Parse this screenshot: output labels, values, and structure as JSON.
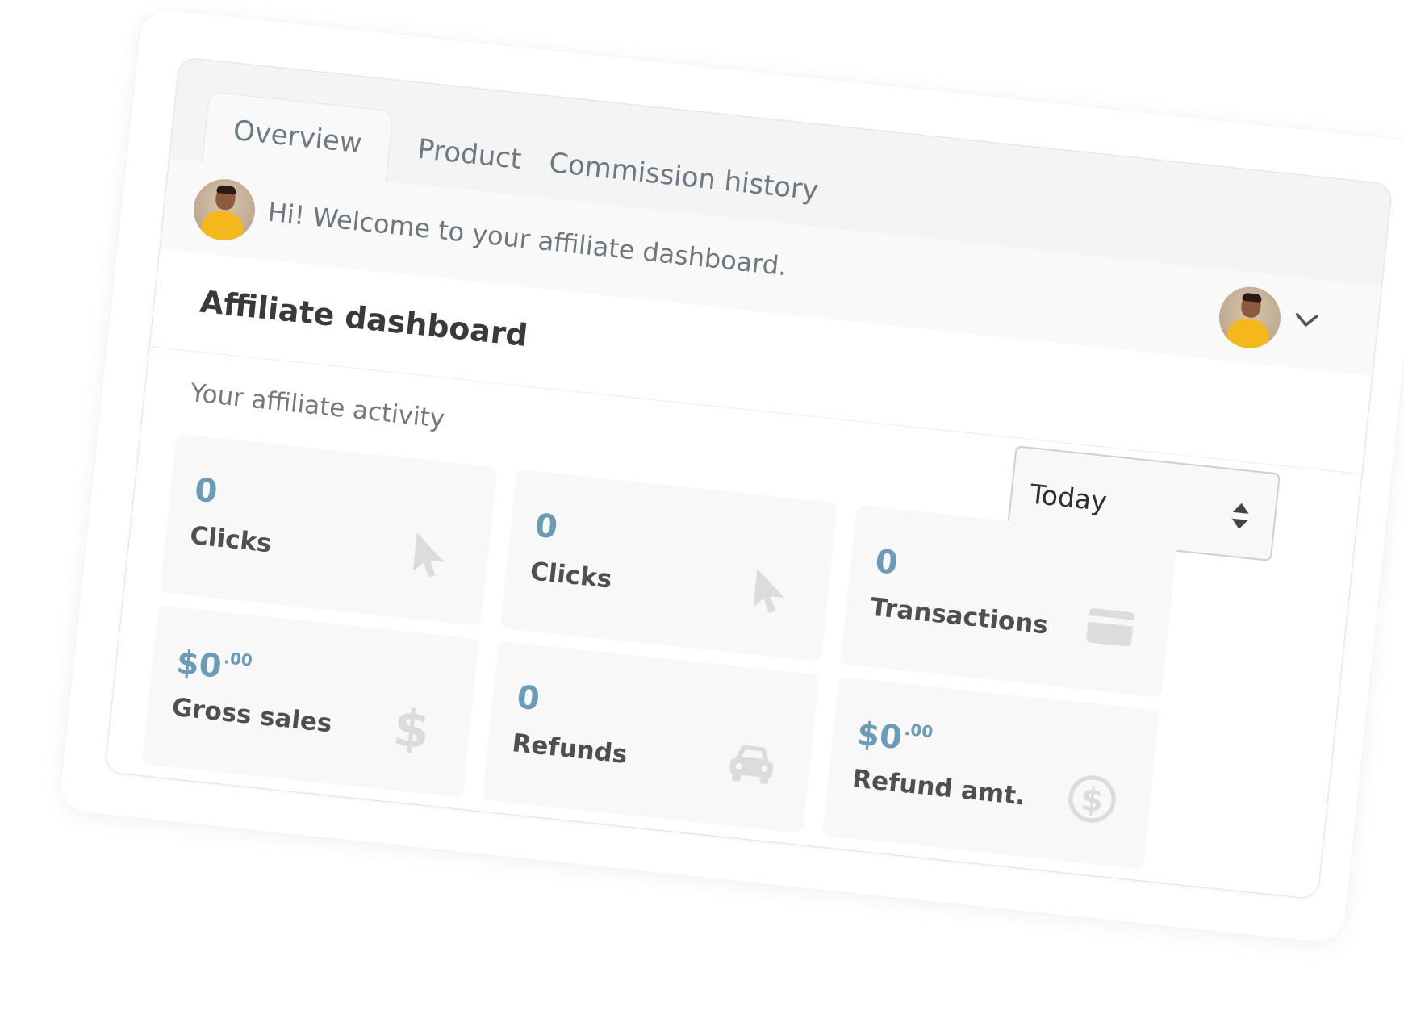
{
  "tabs": [
    {
      "label": "Overview",
      "active": true
    },
    {
      "label": "Product",
      "active": false
    },
    {
      "label": "Commission history",
      "active": false
    }
  ],
  "header": {
    "welcome": "Hi! Welcome to your affiliate dashboard."
  },
  "main": {
    "title": "Affiliate dashboard",
    "activity_label": "Your affiliate activity",
    "period_select": {
      "value": "Today"
    }
  },
  "stats": [
    {
      "value": "0",
      "label": "Clicks",
      "icon": "cursor-icon"
    },
    {
      "value": "0",
      "label": "Clicks",
      "icon": "cursor-icon"
    },
    {
      "value": "0",
      "label": "Transactions",
      "icon": "credit-card-icon"
    },
    {
      "value": "$0",
      "cents": ".00",
      "label": "Gross sales",
      "icon": "dollar-sign-icon"
    },
    {
      "value": "0",
      "label": "Refunds",
      "icon": "car-icon"
    },
    {
      "value": "$0",
      "cents": ".00",
      "label": "Refund amt.",
      "icon": "dollar-circle-icon"
    }
  ],
  "colors": {
    "accent": "#6a9bb8",
    "card_bg": "#f8f8f9",
    "icon": "#dcdcdc",
    "avatar_shirt": "#f4b81c"
  }
}
